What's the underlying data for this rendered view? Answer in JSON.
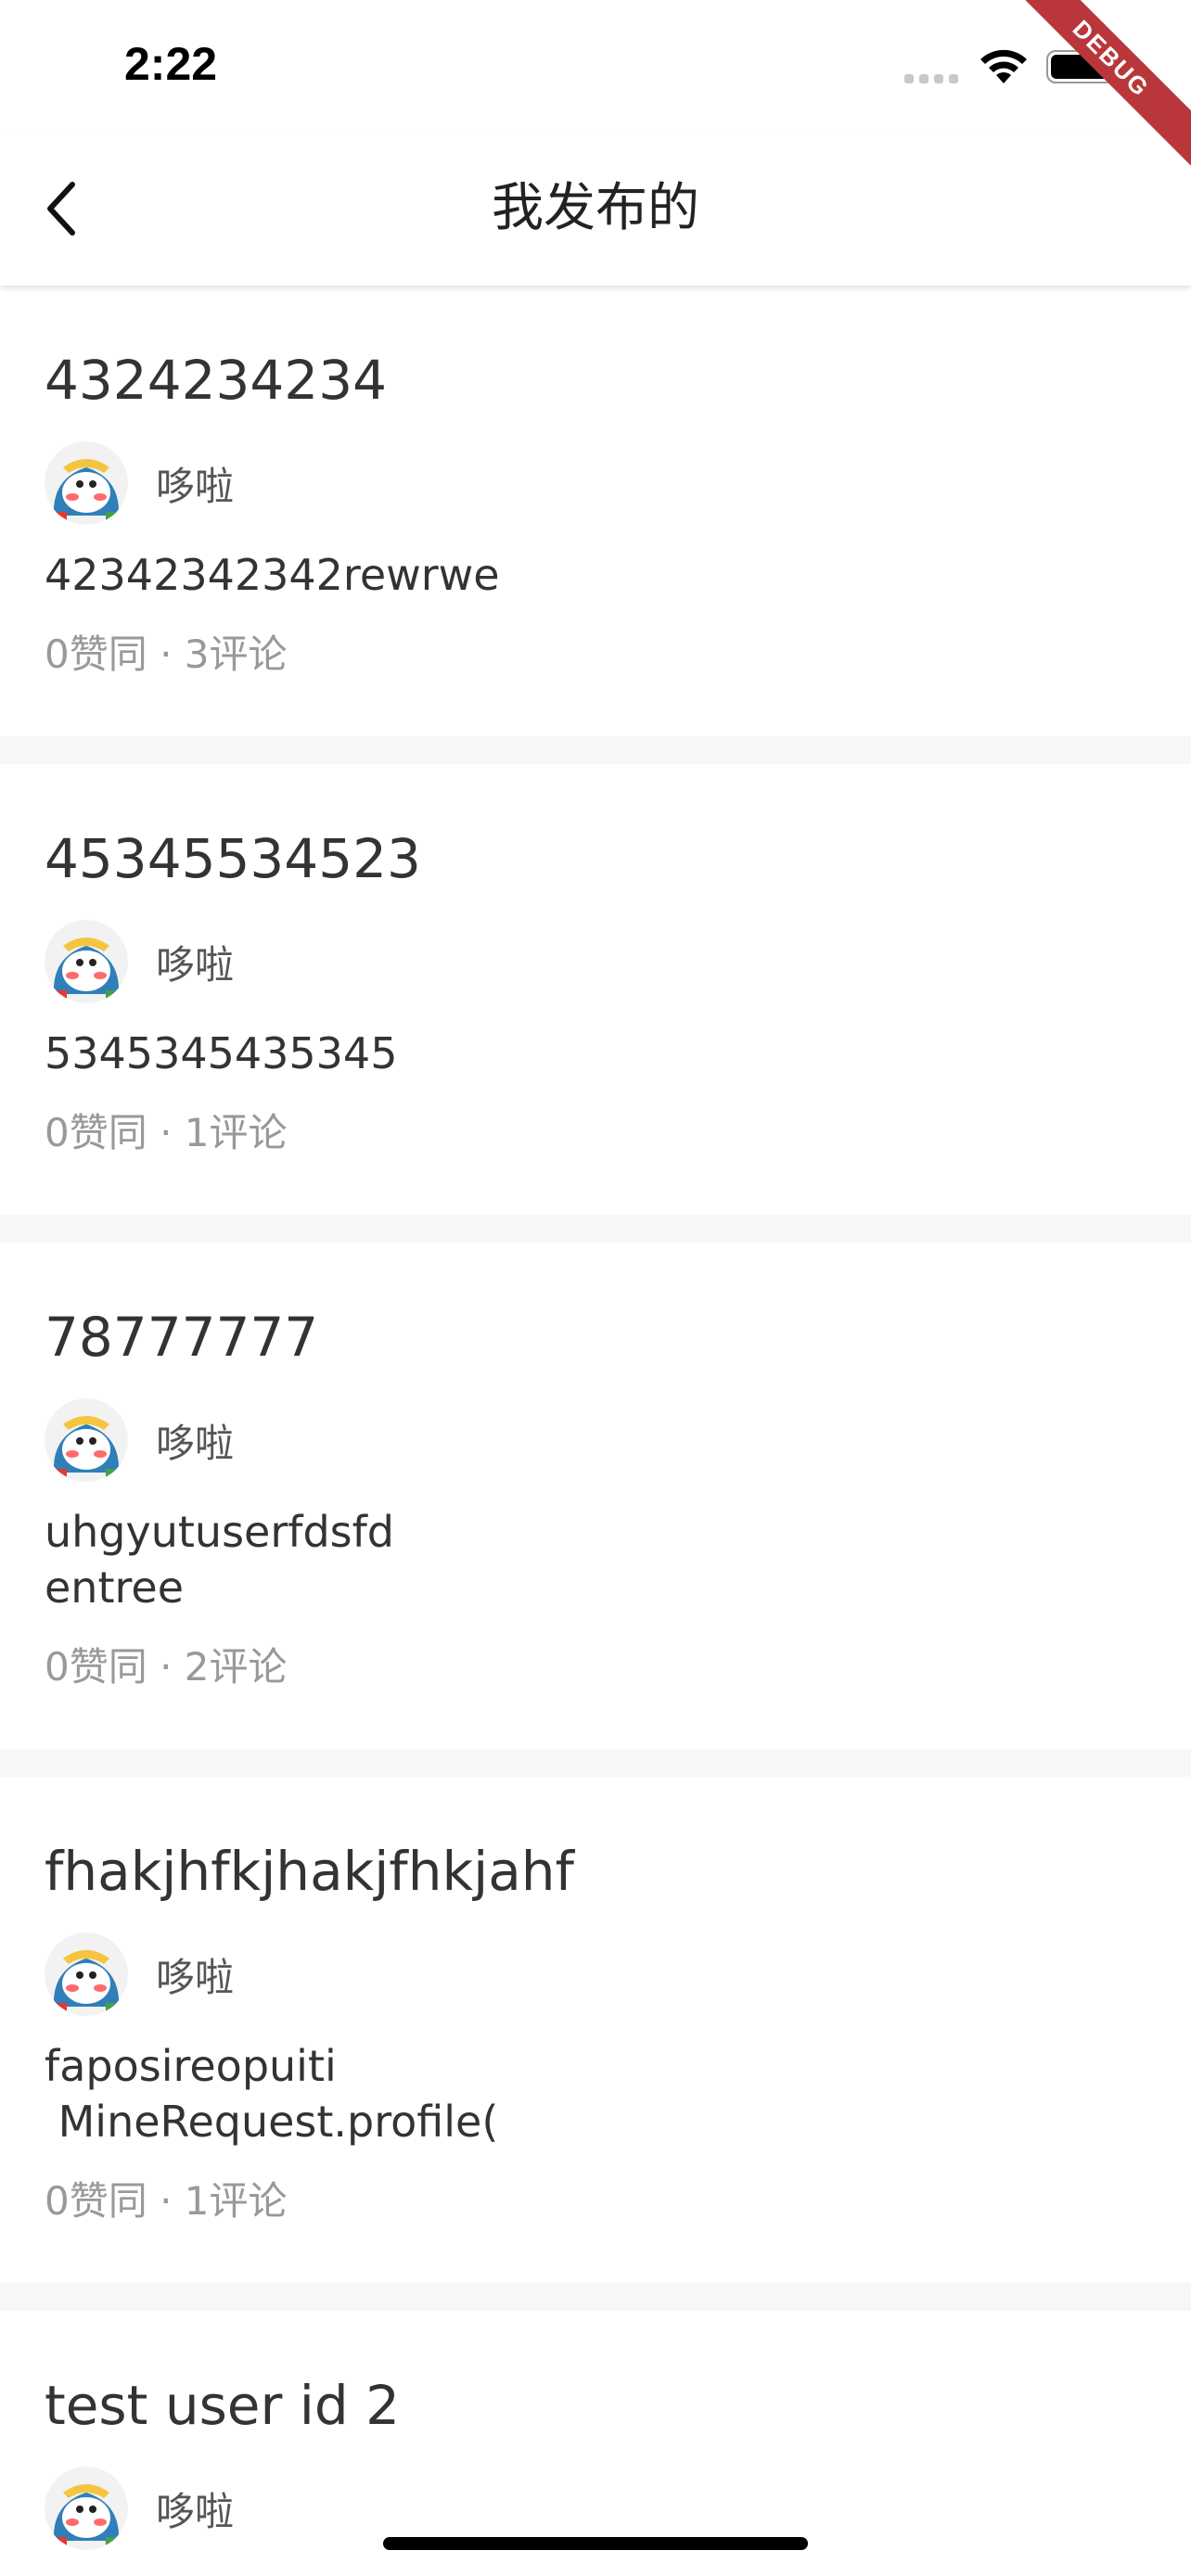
{
  "status_bar": {
    "time": "2:22",
    "debug_label": "DEBUG"
  },
  "app_bar": {
    "title": "我发布的",
    "back_icon": "chevron-left-icon"
  },
  "posts": [
    {
      "title": "4324234234",
      "author": "哆啦",
      "body": "42342342342rewrwe",
      "stats": "0赞同 · 3评论"
    },
    {
      "title": "45345534523",
      "author": "哆啦",
      "body": "5345345435345",
      "stats": "0赞同 · 1评论"
    },
    {
      "title": "78777777",
      "author": "哆啦",
      "body": "uhgyutuserfdsfd\nentree",
      "stats": "0赞同 · 2评论"
    },
    {
      "title": "fhakjhfkjhakjfhkjahf",
      "author": "哆啦",
      "body": "faposireopuiti\n MineRequest.profile(",
      "stats": "0赞同 · 1评论"
    },
    {
      "title": "test user id 2",
      "author": "哆啦",
      "body": "",
      "stats": ""
    }
  ],
  "colors": {
    "background": "#f7f7f7",
    "card": "#ffffff",
    "title_text": "#333333",
    "stats_text": "#999999",
    "debug_ribbon": "#b9373a"
  }
}
